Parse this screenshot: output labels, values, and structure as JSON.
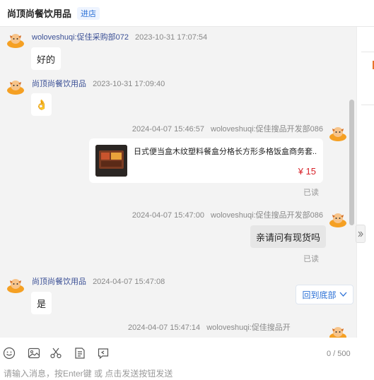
{
  "header": {
    "title": "尚顶尚餐饮用品",
    "shop_link": "进店"
  },
  "messages": [
    {
      "sender": "woloveshuqi:促佳采购部072",
      "time": "2023-10-31 17:07:54",
      "text": "好的"
    },
    {
      "sender": "尚顶尚餐饮用品",
      "time": "2023-10-31 17:09:40",
      "text": "👌"
    },
    {
      "sender": "woloveshuqi:促佳搜品开发部086",
      "time": "2024-04-07 15:46:57",
      "status": "已读"
    },
    {
      "sender": "woloveshuqi:促佳搜品开发部086",
      "time": "2024-04-07 15:47:00",
      "text": "亲请问有现货吗",
      "status": "已读"
    },
    {
      "sender": "尚顶尚餐饮用品",
      "time": "2024-04-07 15:47:08",
      "text": "是"
    },
    {
      "sender": "woloveshuqi:促佳搜品开",
      "time": "2024-04-07 15:47:14"
    }
  ],
  "product": {
    "title": "日式便当盒木纹塑料餐盒分格长方形多格饭盒商务套...",
    "price": "¥ 15"
  },
  "back_to_bottom": "回到底部",
  "input": {
    "placeholder": "请输入消息，按Enter键 或 点击发送按钮发送",
    "counter": "0 / 500"
  },
  "colors": {
    "accent": "#2a6fd6",
    "price": "#d8232a",
    "name": "#3a4f95",
    "avatar": "#f5a023"
  }
}
